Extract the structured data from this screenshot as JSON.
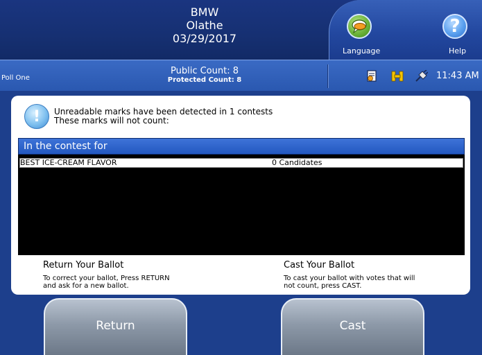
{
  "header": {
    "election_lines": [
      "BMW",
      "Olathe",
      "03/29/2017"
    ],
    "language_label": "Language",
    "help_label": "Help",
    "help_glyph": "?"
  },
  "status_bar": {
    "poll_name": "Poll One",
    "public_count": "Public Count: 8",
    "protected_count": "Protected Count: 8",
    "time": "11:43 AM",
    "icons": [
      "document-icon",
      "machine-status-icon",
      "power-plug-icon"
    ]
  },
  "warning": {
    "line1": "Unreadable marks have been detected in 1 contests",
    "line2": "These marks will not count:"
  },
  "contest_table": {
    "header": "In the contest for",
    "rows": [
      {
        "name": "BEST ICE-CREAM FLAVOR",
        "candidates": "0 Candidates"
      }
    ]
  },
  "instructions": {
    "return_title": "Return Your Ballot",
    "return_line1": "To correct your ballot, Press RETURN",
    "return_line2": "and ask for a new ballot.",
    "cast_title": "Cast Your Ballot",
    "cast_line1": "To cast your ballot with votes that will",
    "cast_line2": "not count, press CAST."
  },
  "buttons": {
    "return_label": "Return",
    "cast_label": "Cast"
  },
  "colors": {
    "header_blue": "#163072",
    "status_blue": "#2a58b0",
    "contest_header_blue": "#2358c0",
    "button_gray": "#8d99a8",
    "language_green": "#6cb33a",
    "help_blue": "#5aa0ef"
  }
}
